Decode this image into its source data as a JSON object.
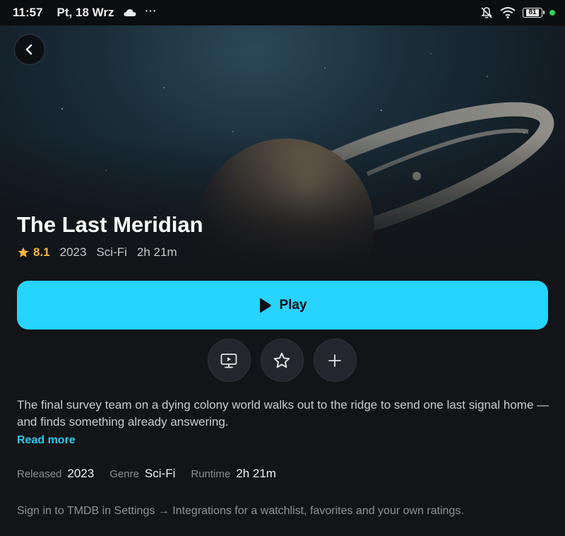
{
  "status_bar": {
    "time": "11:57",
    "date": "Pt, 18 Wrz",
    "more": "···",
    "battery": "81",
    "icons": [
      "cloud-icon",
      "bell-off-icon",
      "wifi-icon",
      "battery-icon",
      "green-dot"
    ]
  },
  "movie": {
    "title": "The Last Meridian",
    "rating": "8.1",
    "year": "2023",
    "genre": "Sci-Fi",
    "runtime": "2h 21m",
    "description": "The final survey team on a dying colony world walks out to the ridge to send one last signal home — and finds something already answering.",
    "read_more": "Read more"
  },
  "actions": {
    "play_label": "Play",
    "buttons": [
      "trailer-icon",
      "star-icon",
      "plus-icon"
    ]
  },
  "details": {
    "released_label": "Released",
    "released_value": "2023",
    "genre_label": "Genre",
    "genre_value": "Sci-Fi",
    "runtime_label": "Runtime",
    "runtime_value": "2h 21m"
  },
  "footer": {
    "signin_hint": "Sign in to TMDB in Settings → Integrations for a watchlist, favorites and your own ratings."
  },
  "colors": {
    "accent": "#27d3ff",
    "rating": "#f5b642",
    "background": "#121418"
  }
}
